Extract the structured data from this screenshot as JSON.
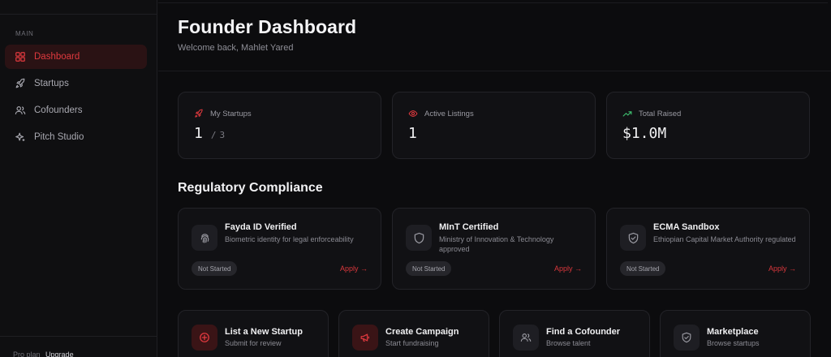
{
  "colors": {
    "accent": "#e0393e",
    "background": "#0c0c0e",
    "card": "#111114"
  },
  "sidebar": {
    "section_label": "MAIN",
    "items": [
      {
        "label": "Dashboard",
        "icon": "grid-icon",
        "active": true
      },
      {
        "label": "Startups",
        "icon": "rocket-icon"
      },
      {
        "label": "Cofounders",
        "icon": "users-icon"
      },
      {
        "label": "Pitch Studio",
        "icon": "sparkles-icon"
      }
    ],
    "plan": "Pro plan",
    "upgrade": "Upgrade"
  },
  "header": {
    "title": "Founder Dashboard",
    "subtitle": "Welcome back, Mahlet Yared"
  },
  "stats": [
    {
      "label": "My Startups",
      "value": "1",
      "separator": "/",
      "total": "3",
      "icon": "rocket-icon"
    },
    {
      "label": "Active Listings",
      "value": "1",
      "icon": "eye-icon"
    },
    {
      "label": "Total Raised",
      "value": "$1.0M",
      "icon": "trending-up-icon"
    }
  ],
  "compliance": {
    "title": "Regulatory Compliance",
    "cards": [
      {
        "title": "Fayda ID Verified",
        "description": "Biometric identity for legal enforceability",
        "status": "Not Started",
        "action": "Apply →",
        "icon": "fingerprint-icon"
      },
      {
        "title": "MInT Certified",
        "description": "Ministry of Innovation & Technology approved",
        "status": "Not Started",
        "action": "Apply →",
        "icon": "shield-icon"
      },
      {
        "title": "ECMA Sandbox",
        "description": "Ethiopian Capital Market Authority regulated",
        "status": "Not Started",
        "action": "Apply →",
        "icon": "shield-check-icon"
      }
    ]
  },
  "quick_actions": [
    {
      "title": "List a New Startup",
      "description": "Submit for review",
      "icon": "plus-circle-icon"
    },
    {
      "title": "Create Campaign",
      "description": "Start fundraising",
      "icon": "megaphone-icon"
    },
    {
      "title": "Find a Cofounder",
      "description": "Browse talent",
      "icon": "users-icon"
    },
    {
      "title": "Marketplace",
      "description": "Browse startups",
      "icon": "shield-check-icon"
    }
  ]
}
